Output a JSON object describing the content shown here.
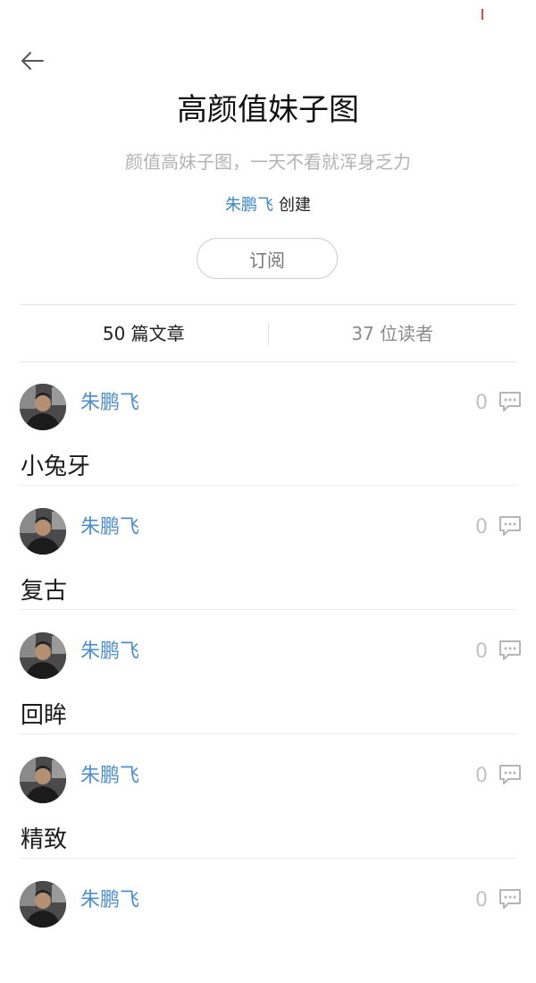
{
  "header": {
    "back_icon": "back-arrow-icon",
    "title": "高颜值妹子图",
    "subtitle": "颜值高妹子图，一天不看就浑身乏力",
    "creator_name": "朱鹏飞",
    "creator_suffix": "创建",
    "subscribe_label": "订阅"
  },
  "stats": {
    "articles": "50 篇文章",
    "readers": "37 位读者"
  },
  "colors": {
    "link_blue": "#4d8ecb",
    "muted_gray": "#b3b3b3",
    "status_red": "#e0454a"
  },
  "posts": [
    {
      "author": "朱鹏飞",
      "comment_count": "0",
      "title": "小兔牙"
    },
    {
      "author": "朱鹏飞",
      "comment_count": "0",
      "title": "复古"
    },
    {
      "author": "朱鹏飞",
      "comment_count": "0",
      "title": "回眸"
    },
    {
      "author": "朱鹏飞",
      "comment_count": "0",
      "title": "精致"
    },
    {
      "author": "朱鹏飞",
      "comment_count": "0",
      "title": ""
    }
  ]
}
